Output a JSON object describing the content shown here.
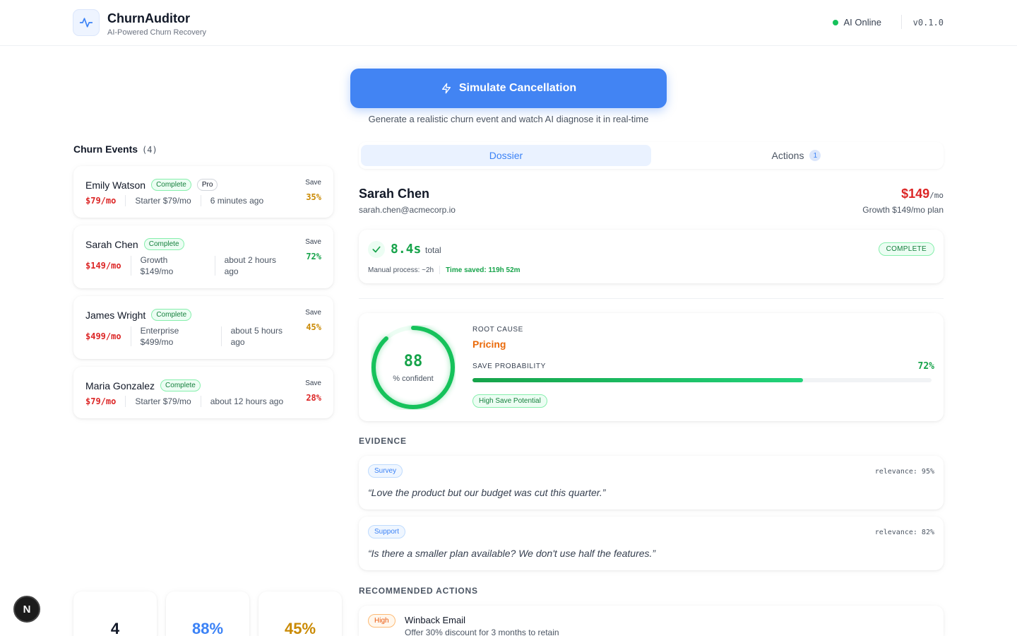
{
  "app": {
    "title": "ChurnAuditor",
    "subtitle": "AI-Powered Churn Recovery",
    "status": "AI Online",
    "version": "v0.1.0"
  },
  "simulate": {
    "label": "Simulate Cancellation",
    "caption": "Generate a realistic churn event and watch AI diagnose it in real-time"
  },
  "events": {
    "title": "Churn Events",
    "count": "(4)",
    "save_label": "Save",
    "items": [
      {
        "name": "Emily Watson",
        "status": "Complete",
        "tag": "Pro",
        "price": "$79/mo",
        "plan": "Starter $79/mo",
        "time": "6 minutes ago",
        "save": "35%"
      },
      {
        "name": "Sarah Chen",
        "status": "Complete",
        "price": "$149/mo",
        "plan_line1": "Growth",
        "plan_line2": "$149/mo",
        "time_line1": "about 2 hours",
        "time_line2": "ago",
        "save": "72%"
      },
      {
        "name": "James Wright",
        "status": "Complete",
        "price": "$499/mo",
        "plan_line1": "Enterprise",
        "plan_line2": "$499/mo",
        "time_line1": "about 5 hours",
        "time_line2": "ago",
        "save": "45%"
      },
      {
        "name": "Maria Gonzalez",
        "status": "Complete",
        "price": "$79/mo",
        "plan": "Starter $79/mo",
        "time": "about 12 hours ago",
        "save": "28%"
      }
    ]
  },
  "stats": [
    {
      "value": "4",
      "color": "#111827"
    },
    {
      "value": "88%",
      "color": "#3b82f6"
    },
    {
      "value": "45%",
      "color": "#ca8a04"
    }
  ],
  "tabs": {
    "dossier": "Dossier",
    "actions": "Actions",
    "actions_count": "1"
  },
  "customer": {
    "name": "Sarah Chen",
    "email": "sarah.chen@acmecorp.io",
    "price": "$149",
    "price_unit": "/mo",
    "plan": "Growth $149/mo plan"
  },
  "timing": {
    "value": "8.4s",
    "unit": "total",
    "status": "COMPLETE",
    "manual": "Manual process: ~2h",
    "saved": "Time saved: 119h 52m"
  },
  "diagnosis": {
    "confidence": "88",
    "confidence_fraction": 0.88,
    "confidence_label": "% confident",
    "root_cause_label": "ROOT CAUSE",
    "root_cause": "Pricing",
    "save_prob_label": "SAVE PROBABILITY",
    "save_prob": "72%",
    "save_prob_fraction": 0.72,
    "save_badge": "High Save Potential"
  },
  "evidence": {
    "title": "EVIDENCE",
    "items": [
      {
        "source": "Survey",
        "relevance": "relevance: 95%",
        "quote": "“Love the product but our budget was cut this quarter.”"
      },
      {
        "source": "Support",
        "relevance": "relevance: 82%",
        "quote": "“Is there a smaller plan available? We don't use half the features.”"
      }
    ]
  },
  "recommended": {
    "title": "RECOMMENDED ACTIONS",
    "items": [
      {
        "priority": "High",
        "title": "Winback Email",
        "desc": "Offer 30% discount for 3 months to retain"
      }
    ]
  },
  "colors": {
    "primary": "#4284f3",
    "success": "#16a34a",
    "danger": "#dc2626",
    "warning": "#ca8a04",
    "orange": "#ea6a0a"
  }
}
